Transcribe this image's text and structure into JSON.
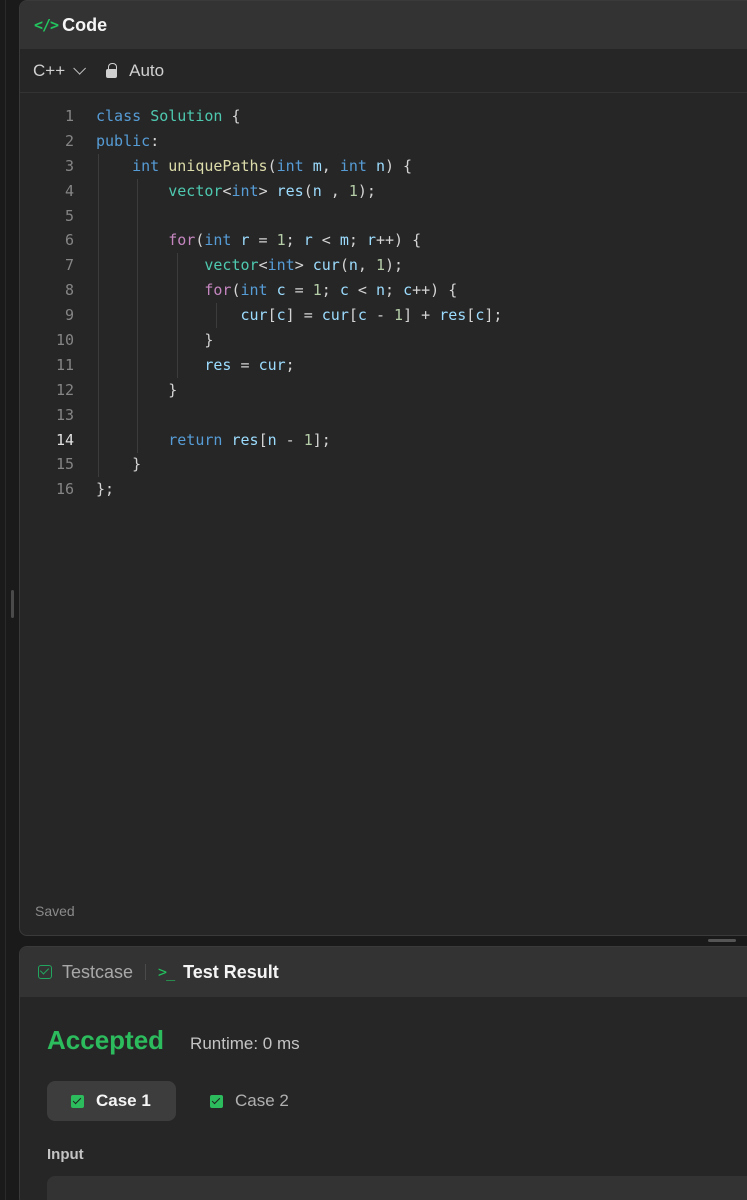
{
  "code_panel": {
    "title": "Code",
    "language": "C++",
    "mode": "Auto",
    "status": "Saved",
    "active_line": 14
  },
  "code_lines": [
    {
      "n": "1",
      "text": "class Solution {"
    },
    {
      "n": "2",
      "text": "public:"
    },
    {
      "n": "3",
      "text": "    int uniquePaths(int m, int n) {"
    },
    {
      "n": "4",
      "text": "        vector<int> res(n , 1);"
    },
    {
      "n": "5",
      "text": ""
    },
    {
      "n": "6",
      "text": "        for(int r = 1; r < m; r++) {"
    },
    {
      "n": "7",
      "text": "            vector<int> cur(n, 1);"
    },
    {
      "n": "8",
      "text": "            for(int c = 1; c < n; c++) {"
    },
    {
      "n": "9",
      "text": "                cur[c] = cur[c - 1] + res[c];"
    },
    {
      "n": "10",
      "text": "            }"
    },
    {
      "n": "11",
      "text": "            res = cur;"
    },
    {
      "n": "12",
      "text": "        }"
    },
    {
      "n": "13",
      "text": ""
    },
    {
      "n": "14",
      "text": "        return res[n - 1];"
    },
    {
      "n": "15",
      "text": "    }"
    },
    {
      "n": "16",
      "text": "};"
    }
  ],
  "result_panel": {
    "tab_testcase": "Testcase",
    "tab_result": "Test Result",
    "verdict": "Accepted",
    "runtime": "Runtime: 0 ms",
    "case1": "Case 1",
    "case2": "Case 2",
    "input_label": "Input"
  },
  "colors": {
    "accent_green": "#2cbb5d",
    "keyword": "#569cd6",
    "control": "#c586c0",
    "type": "#4ec9b0",
    "function": "#dcdcaa",
    "variable": "#9cdcfe",
    "number": "#b5cea8"
  },
  "icons": {
    "code": "code-brackets-icon",
    "lock": "lock-icon",
    "chevron": "chevron-down-icon",
    "testcase": "checkbox-icon",
    "terminal": "terminal-prompt-icon",
    "case_status": "check-square-icon"
  }
}
